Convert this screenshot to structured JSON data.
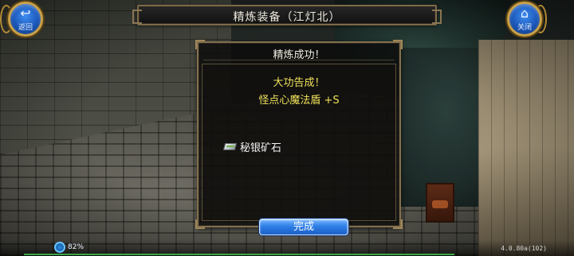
{
  "window": {
    "title": "精炼装备（江灯北）"
  },
  "corner_buttons": {
    "back_label": "返回",
    "close_label": "关闭",
    "back_icon": "back-arrow-icon",
    "close_icon": "home-icon"
  },
  "dialog": {
    "header": "精炼成功！",
    "success_text": "大功告成！",
    "item_result": "怪点心魔法盾  +S",
    "material_name": "秘银矿石",
    "material_icon": "ore-icon",
    "done_label": "完成"
  },
  "status": {
    "battery": "82%",
    "version": "4.0.80a(102)"
  },
  "colors": {
    "highlight_text": "#f0e25a",
    "button_blue": "#2f7fe6",
    "frame_gold": "#82704f"
  }
}
